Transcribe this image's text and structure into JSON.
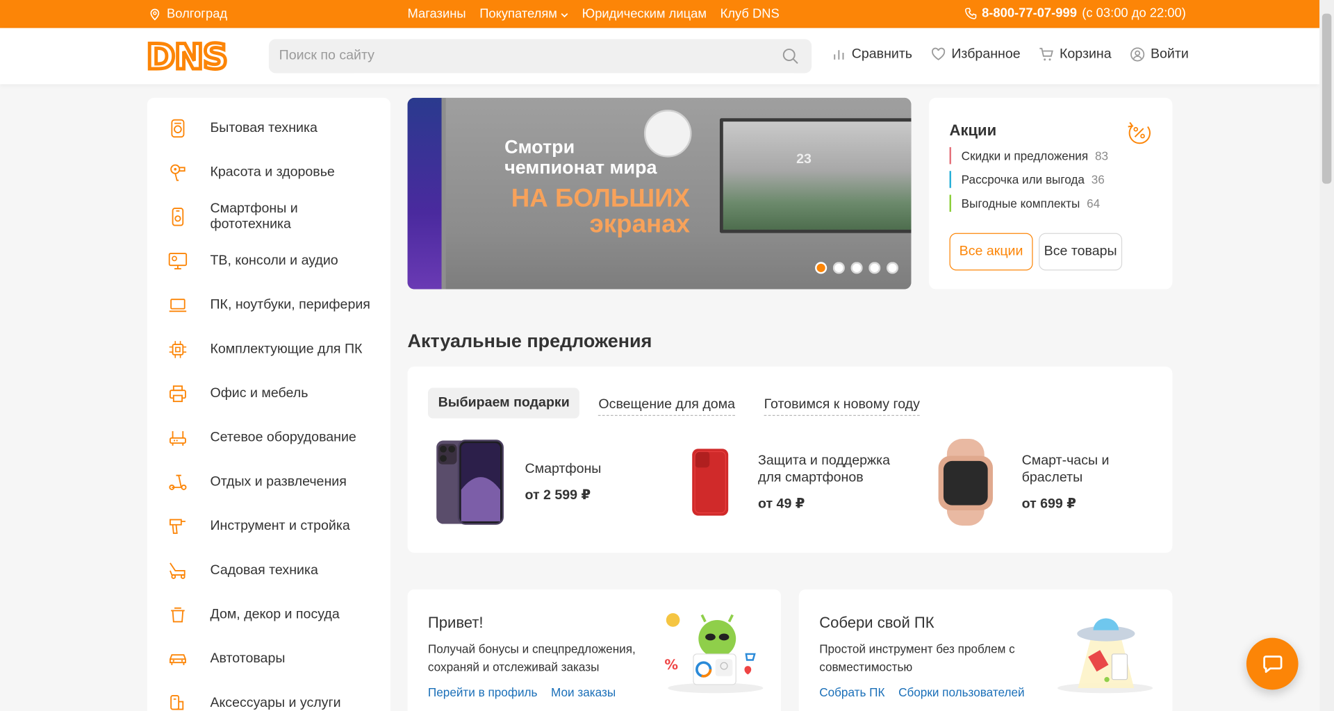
{
  "topbar": {
    "city": "Волгоград",
    "links": [
      "Магазины",
      "Покупателям",
      "Юридическим лицам",
      "Клуб DNS"
    ],
    "phone": "8-800-77-07-999",
    "hours": "(с 03:00 до 22:00)"
  },
  "header": {
    "logo": "DNS",
    "search_placeholder": "Поиск по сайту",
    "actions": {
      "compare": "Сравнить",
      "favorites": "Избранное",
      "cart": "Корзина",
      "login": "Войти"
    }
  },
  "sidebar": {
    "items": [
      {
        "label": "Бытовая техника",
        "icon": "appliance-icon"
      },
      {
        "label": "Красота и здоровье",
        "icon": "hairdryer-icon"
      },
      {
        "label": "Смартфоны и фототехника",
        "icon": "smartphone-icon"
      },
      {
        "label": "ТВ, консоли и аудио",
        "icon": "tv-icon"
      },
      {
        "label": "ПК, ноутбуки, периферия",
        "icon": "laptop-icon"
      },
      {
        "label": "Комплектующие для ПК",
        "icon": "chip-icon"
      },
      {
        "label": "Офис и мебель",
        "icon": "printer-icon"
      },
      {
        "label": "Сетевое оборудование",
        "icon": "router-icon"
      },
      {
        "label": "Отдых и развлечения",
        "icon": "scooter-icon"
      },
      {
        "label": "Инструмент и стройка",
        "icon": "drill-icon"
      },
      {
        "label": "Садовая техника",
        "icon": "lawnmower-icon"
      },
      {
        "label": "Дом, декор и посуда",
        "icon": "pot-icon"
      },
      {
        "label": "Автотовары",
        "icon": "car-icon"
      },
      {
        "label": "Аксессуары и услуги",
        "icon": "accessories-icon"
      }
    ]
  },
  "banner": {
    "line1": "Смотри",
    "line2": "чемпионат мира",
    "line3": "НА БОЛЬШИХ",
    "line4": "экранах",
    "jersey_number": "23",
    "slides": 5,
    "active_slide": 1
  },
  "promo": {
    "title": "Акции",
    "rows": [
      {
        "label": "Скидки и предложения",
        "count": "83",
        "color": "#e4717a"
      },
      {
        "label": "Рассрочка или выгода",
        "count": "36",
        "color": "#29b0d8"
      },
      {
        "label": "Выгодные комплекты",
        "count": "64",
        "color": "#8ccf3a"
      }
    ],
    "btn_all_promos": "Все акции",
    "btn_all_goods": "Все товары"
  },
  "offers": {
    "title": "Актуальные предложения",
    "tabs": [
      "Выбираем подарки",
      "Освещение для дома",
      "Готовимся к новому году"
    ],
    "products": [
      {
        "name": "Смартфоны",
        "price": "от 2 599 ₽"
      },
      {
        "name": "Защита и поддержка для смартфонов",
        "price": "от 49 ₽"
      },
      {
        "name": "Смарт-часы и браслеты",
        "price": "от 699 ₽"
      }
    ]
  },
  "cards": {
    "profile": {
      "title": "Привет!",
      "text": "Получай бонусы и спецпредложения, сохраняй и отслеживай заказы",
      "link1": "Перейти в профиль",
      "link2": "Мои заказы"
    },
    "pc": {
      "title": "Собери свой ПК",
      "text": "Простой инструмент без проблем с совместимостью",
      "link1": "Собрать ПК",
      "link2": "Сборки пользователей"
    }
  },
  "colors": {
    "brand": "#fc8507",
    "link": "#1a6fb8"
  }
}
